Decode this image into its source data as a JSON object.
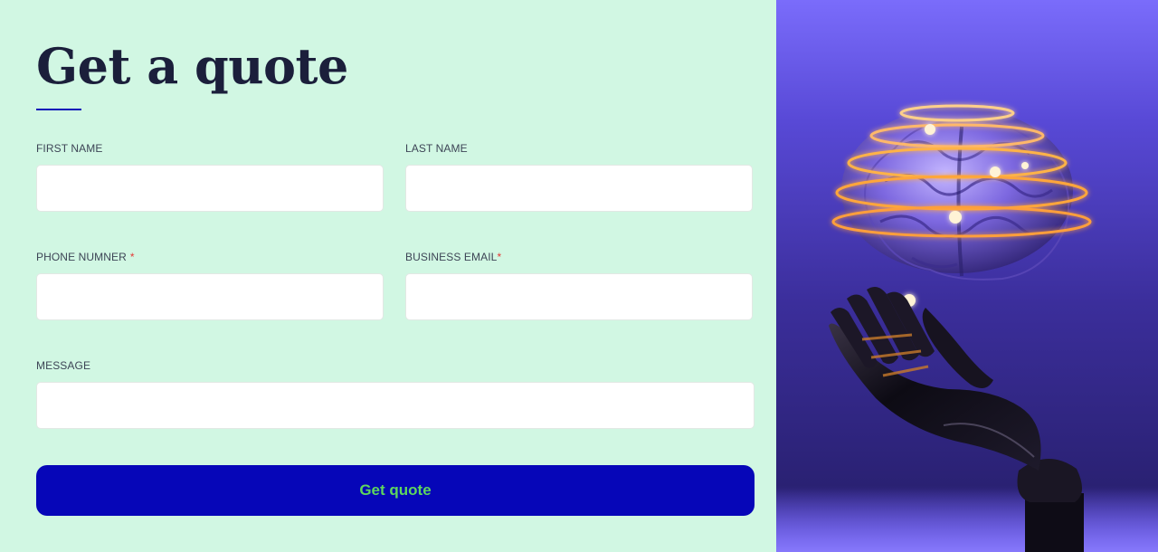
{
  "form": {
    "title": "Get a quote",
    "fields": {
      "first_name": {
        "label": "FIRST NAME",
        "value": "",
        "placeholder": ""
      },
      "last_name": {
        "label": "LAST NAME",
        "value": "",
        "placeholder": ""
      },
      "phone": {
        "label": "PHONE NUMNER",
        "required_mark": "*",
        "value": "",
        "placeholder": ""
      },
      "email": {
        "label": "BUSINESS EMAIL",
        "required_mark": "*",
        "value": "",
        "placeholder": ""
      },
      "message": {
        "label": "MESSAGE",
        "value": "",
        "placeholder": ""
      }
    },
    "submit_label": "Get quote"
  },
  "colors": {
    "form_background": "#d1f7e3",
    "title": "#1b1f3b",
    "accent": "#0a12b8",
    "button_background": "#0606b8",
    "button_text": "#5ed65e",
    "required": "#e53935",
    "hero_purple": "#5849d6",
    "glow": "#ffb347"
  },
  "hero": {
    "image_subject": "robotic-hand-holding-glowing-brain-illustration"
  }
}
